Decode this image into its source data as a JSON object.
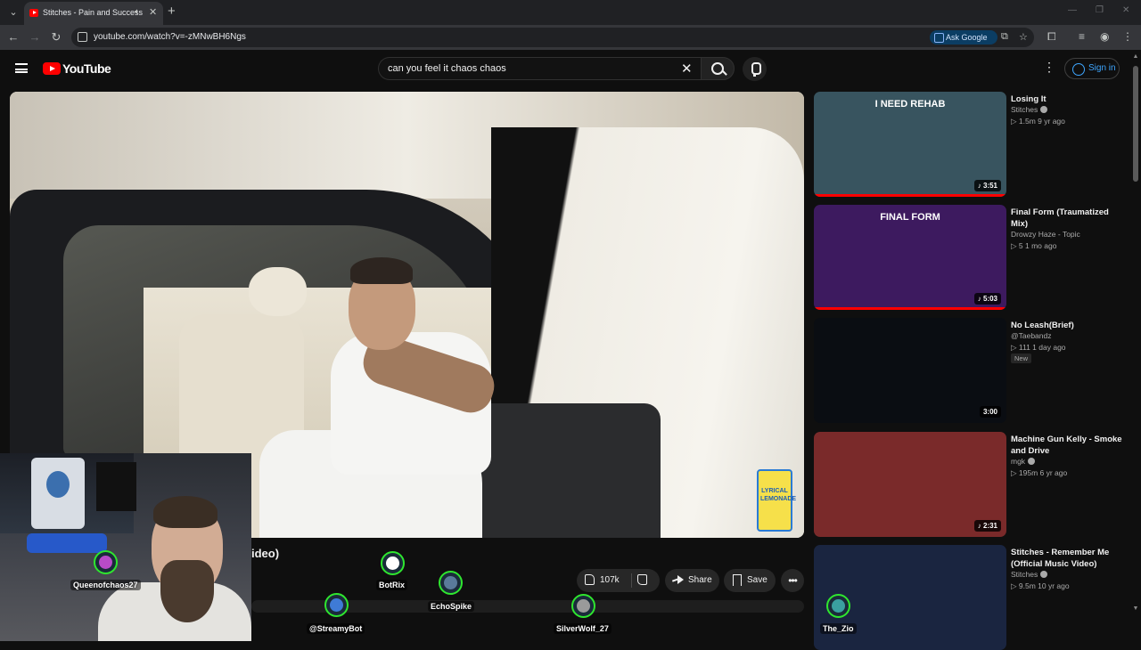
{
  "browser": {
    "tab_title": "Stitches - Pain and Success",
    "url": "youtube.com/watch?v=-zMNwBH6Ngs",
    "ask_google": "Ask Google"
  },
  "masthead": {
    "logo_text": "YouTube",
    "search_query": "can you feel it chaos chaos",
    "signin_label": "Sign in"
  },
  "video": {
    "title_visible": "ideo)",
    "brand_label": "LYRICAL LEMONADE",
    "likes": "107k",
    "share_label": "Share",
    "save_label": "Save",
    "more_label": "•••"
  },
  "sidebar": [
    {
      "title": "Losing It",
      "channel": "Stitches",
      "verified": true,
      "meta": "▷ 1.5m  9 yr ago",
      "duration": "♪ 3:51",
      "badge": "",
      "thumb_color": "#38545f",
      "thumb_text": "I NEED REHAB",
      "watched": true
    },
    {
      "title": "Final Form (Traumatized Mix)",
      "channel": "Drowzy Haze - Topic",
      "verified": false,
      "meta": "▷ 5  1 mo ago",
      "duration": "♪ 5:03",
      "badge": "",
      "thumb_color": "#3d1a5f",
      "thumb_text": "FINAL FORM",
      "watched": true
    },
    {
      "title": "No Leash(Brief)",
      "channel": "@Taebandz",
      "verified": false,
      "meta": "▷ 111  1 day ago",
      "duration": "3:00",
      "badge": "New",
      "thumb_color": "#0a0d12",
      "thumb_text": "",
      "watched": false
    },
    {
      "title": "Machine Gun Kelly - Smoke and Drive",
      "channel": "mgk",
      "verified": true,
      "meta": "▷ 195m  6 yr ago",
      "duration": "♪ 2:31",
      "badge": "",
      "thumb_color": "#7a2a2a",
      "thumb_text": "",
      "watched": false
    },
    {
      "title": "Stitches  - Remember Me (Official Music Video)",
      "channel": "Stitches",
      "verified": true,
      "meta": "▷ 9.5m  10 yr ago",
      "duration": "",
      "badge": "",
      "thumb_color": "#1a2540",
      "thumb_text": "",
      "watched": false
    }
  ],
  "viewers": [
    {
      "name": "Queenofchaos27",
      "color": "#b84bc8"
    },
    {
      "name": "BotRix",
      "color": "#ffffff"
    },
    {
      "name": "EchoSpike",
      "color": "#5a7a9a"
    },
    {
      "name": "@StreamyBot",
      "color": "#3f7bd6"
    },
    {
      "name": "SilverWolf_27",
      "color": "#9a9a9a"
    },
    {
      "name": "The_Zio",
      "color": "#3aa0a0"
    }
  ]
}
